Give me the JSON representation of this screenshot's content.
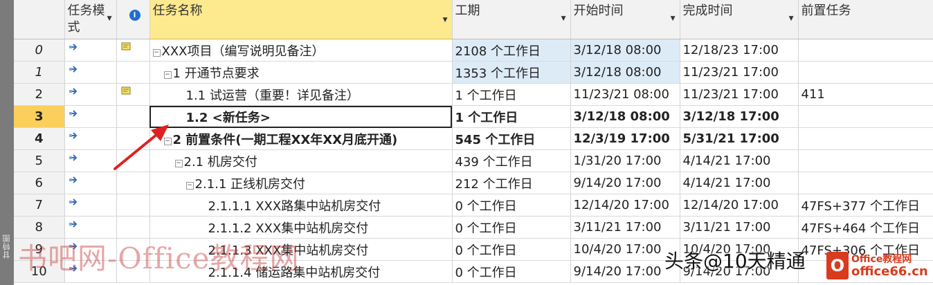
{
  "sidebar": {
    "label": "甘特图"
  },
  "headers": {
    "mode": "任务模式",
    "name": "任务名称",
    "duration": "工期",
    "start": "开始时间",
    "finish": "完成时间",
    "predecessors": "前置任务",
    "info_icon": "i"
  },
  "rows": [
    {
      "id": "0",
      "note": true,
      "name": "XXX项目（编写说明见备注）",
      "duration": "2108 个工作日",
      "start": "3/12/18 08:00",
      "finish": "12/18/23 17:00",
      "pred": ""
    },
    {
      "id": "1",
      "note": false,
      "name": "1 开通节点要求",
      "duration": "1353 个工作日",
      "start": "3/12/18 08:00",
      "finish": "11/23/21 17:00",
      "pred": ""
    },
    {
      "id": "2",
      "note": true,
      "name": "1.1 试运营（重要！详见备注）",
      "duration": "1 个工作日",
      "start": "11/23/21 08:00",
      "finish": "11/23/21 17:00",
      "pred": "411"
    },
    {
      "id": "3",
      "note": false,
      "name": "1.2 <新任务>",
      "duration": "1 个工作日",
      "start": "3/12/18 08:00",
      "finish": "3/12/18 17:00",
      "pred": ""
    },
    {
      "id": "4",
      "note": false,
      "name": "2 前置条件(一期工程XX年XX月底开通)",
      "duration": "545 个工作日",
      "start": "12/3/19 17:00",
      "finish": "5/31/21 17:00",
      "pred": ""
    },
    {
      "id": "5",
      "note": false,
      "name": "2.1 机房交付",
      "duration": "439 个工作日",
      "start": "1/31/20 17:00",
      "finish": "4/14/21 17:00",
      "pred": ""
    },
    {
      "id": "6",
      "note": false,
      "name": "2.1.1 正线机房交付",
      "duration": "212 个工作日",
      "start": "9/14/20 17:00",
      "finish": "4/14/21 17:00",
      "pred": ""
    },
    {
      "id": "7",
      "note": false,
      "name": "2.1.1.1 XXX路集中站机房交付",
      "duration": "0 个工作日",
      "start": "12/14/20 17:00",
      "finish": "12/14/20 17:00",
      "pred": "47FS+377 个工作日"
    },
    {
      "id": "8",
      "note": false,
      "name": "2.1.1.2 XXX集中站机房交付",
      "duration": "0 个工作日",
      "start": "3/11/21 17:00",
      "finish": "3/11/21 17:00",
      "pred": "47FS+464 个工作日"
    },
    {
      "id": "9",
      "note": false,
      "name": "2.1.1.3 XXX集中站机房交付",
      "duration": "0 个工作日",
      "start": "10/4/20 17:00",
      "finish": "10/4/20 17:00",
      "pred": "47FS+306 个工作日"
    },
    {
      "id": "10",
      "note": false,
      "name": "2.1.1.4 储运路集中站机房交付",
      "duration": "0 个工作日",
      "start": "9/14/20 17:00",
      "finish": "9/14/20 17:00",
      "pred": ""
    }
  ],
  "watermarks": {
    "left": "书吧网-Office教程网",
    "right": "头条@10天精通",
    "logo_top": "Office教程网",
    "logo_bottom": "office66.cn",
    "logo_letter": "O"
  },
  "colors": {
    "selected_header": "#fde98e",
    "selected_row": "#fbcf5b",
    "arrow": "#e02020",
    "highlight": "#ddebf7"
  }
}
